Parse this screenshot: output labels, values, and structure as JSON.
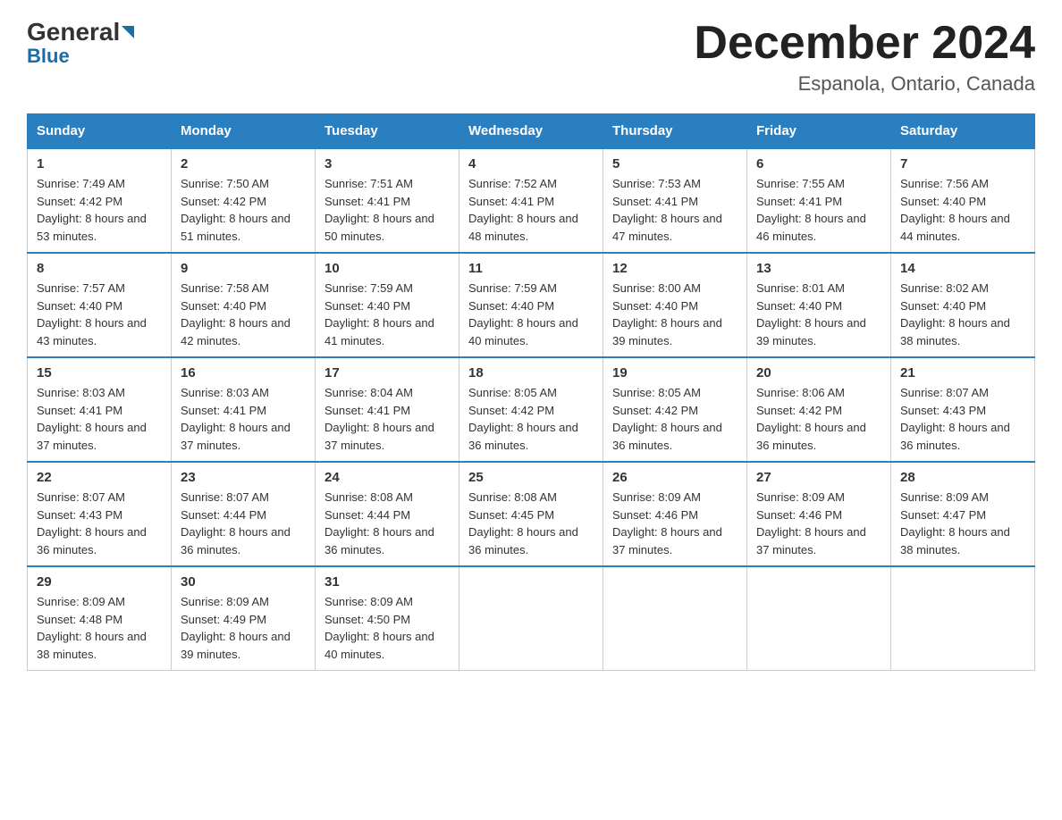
{
  "header": {
    "logo_general": "General",
    "logo_blue": "Blue",
    "month_title": "December 2024",
    "location": "Espanola, Ontario, Canada"
  },
  "weekdays": [
    "Sunday",
    "Monday",
    "Tuesday",
    "Wednesday",
    "Thursday",
    "Friday",
    "Saturday"
  ],
  "weeks": [
    [
      {
        "day": "1",
        "sunrise": "7:49 AM",
        "sunset": "4:42 PM",
        "daylight": "8 hours and 53 minutes."
      },
      {
        "day": "2",
        "sunrise": "7:50 AM",
        "sunset": "4:42 PM",
        "daylight": "8 hours and 51 minutes."
      },
      {
        "day": "3",
        "sunrise": "7:51 AM",
        "sunset": "4:41 PM",
        "daylight": "8 hours and 50 minutes."
      },
      {
        "day": "4",
        "sunrise": "7:52 AM",
        "sunset": "4:41 PM",
        "daylight": "8 hours and 48 minutes."
      },
      {
        "day": "5",
        "sunrise": "7:53 AM",
        "sunset": "4:41 PM",
        "daylight": "8 hours and 47 minutes."
      },
      {
        "day": "6",
        "sunrise": "7:55 AM",
        "sunset": "4:41 PM",
        "daylight": "8 hours and 46 minutes."
      },
      {
        "day": "7",
        "sunrise": "7:56 AM",
        "sunset": "4:40 PM",
        "daylight": "8 hours and 44 minutes."
      }
    ],
    [
      {
        "day": "8",
        "sunrise": "7:57 AM",
        "sunset": "4:40 PM",
        "daylight": "8 hours and 43 minutes."
      },
      {
        "day": "9",
        "sunrise": "7:58 AM",
        "sunset": "4:40 PM",
        "daylight": "8 hours and 42 minutes."
      },
      {
        "day": "10",
        "sunrise": "7:59 AM",
        "sunset": "4:40 PM",
        "daylight": "8 hours and 41 minutes."
      },
      {
        "day": "11",
        "sunrise": "7:59 AM",
        "sunset": "4:40 PM",
        "daylight": "8 hours and 40 minutes."
      },
      {
        "day": "12",
        "sunrise": "8:00 AM",
        "sunset": "4:40 PM",
        "daylight": "8 hours and 39 minutes."
      },
      {
        "day": "13",
        "sunrise": "8:01 AM",
        "sunset": "4:40 PM",
        "daylight": "8 hours and 39 minutes."
      },
      {
        "day": "14",
        "sunrise": "8:02 AM",
        "sunset": "4:40 PM",
        "daylight": "8 hours and 38 minutes."
      }
    ],
    [
      {
        "day": "15",
        "sunrise": "8:03 AM",
        "sunset": "4:41 PM",
        "daylight": "8 hours and 37 minutes."
      },
      {
        "day": "16",
        "sunrise": "8:03 AM",
        "sunset": "4:41 PM",
        "daylight": "8 hours and 37 minutes."
      },
      {
        "day": "17",
        "sunrise": "8:04 AM",
        "sunset": "4:41 PM",
        "daylight": "8 hours and 37 minutes."
      },
      {
        "day": "18",
        "sunrise": "8:05 AM",
        "sunset": "4:42 PM",
        "daylight": "8 hours and 36 minutes."
      },
      {
        "day": "19",
        "sunrise": "8:05 AM",
        "sunset": "4:42 PM",
        "daylight": "8 hours and 36 minutes."
      },
      {
        "day": "20",
        "sunrise": "8:06 AM",
        "sunset": "4:42 PM",
        "daylight": "8 hours and 36 minutes."
      },
      {
        "day": "21",
        "sunrise": "8:07 AM",
        "sunset": "4:43 PM",
        "daylight": "8 hours and 36 minutes."
      }
    ],
    [
      {
        "day": "22",
        "sunrise": "8:07 AM",
        "sunset": "4:43 PM",
        "daylight": "8 hours and 36 minutes."
      },
      {
        "day": "23",
        "sunrise": "8:07 AM",
        "sunset": "4:44 PM",
        "daylight": "8 hours and 36 minutes."
      },
      {
        "day": "24",
        "sunrise": "8:08 AM",
        "sunset": "4:44 PM",
        "daylight": "8 hours and 36 minutes."
      },
      {
        "day": "25",
        "sunrise": "8:08 AM",
        "sunset": "4:45 PM",
        "daylight": "8 hours and 36 minutes."
      },
      {
        "day": "26",
        "sunrise": "8:09 AM",
        "sunset": "4:46 PM",
        "daylight": "8 hours and 37 minutes."
      },
      {
        "day": "27",
        "sunrise": "8:09 AM",
        "sunset": "4:46 PM",
        "daylight": "8 hours and 37 minutes."
      },
      {
        "day": "28",
        "sunrise": "8:09 AM",
        "sunset": "4:47 PM",
        "daylight": "8 hours and 38 minutes."
      }
    ],
    [
      {
        "day": "29",
        "sunrise": "8:09 AM",
        "sunset": "4:48 PM",
        "daylight": "8 hours and 38 minutes."
      },
      {
        "day": "30",
        "sunrise": "8:09 AM",
        "sunset": "4:49 PM",
        "daylight": "8 hours and 39 minutes."
      },
      {
        "day": "31",
        "sunrise": "8:09 AM",
        "sunset": "4:50 PM",
        "daylight": "8 hours and 40 minutes."
      },
      null,
      null,
      null,
      null
    ]
  ],
  "labels": {
    "sunrise": "Sunrise: ",
    "sunset": "Sunset: ",
    "daylight": "Daylight: "
  }
}
